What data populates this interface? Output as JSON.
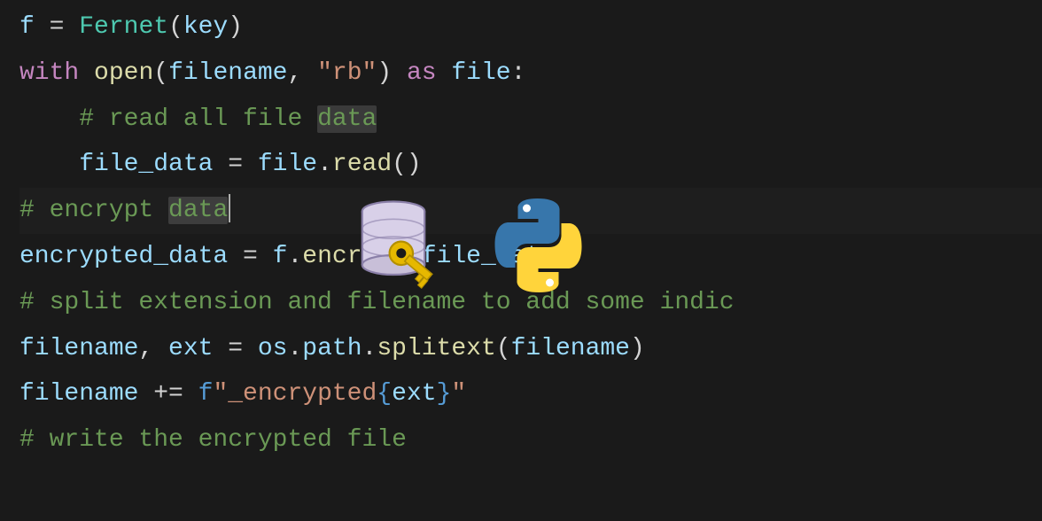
{
  "code": {
    "line1": {
      "var1": "f",
      "eq": " = ",
      "cls": "Fernet",
      "open": "(",
      "arg": "key",
      "close": ")"
    },
    "line2": {
      "kw1": "with",
      "sp1": " ",
      "fn": "open",
      "open": "(",
      "arg1": "filename",
      "comma": ", ",
      "str": "\"rb\"",
      "close": ")",
      "sp2": " ",
      "kw2": "as",
      "sp3": " ",
      "var": "file",
      "colon": ":"
    },
    "line3": {
      "indent": "    ",
      "comment_start": "# read all file ",
      "comment_hl": "data"
    },
    "line4": {
      "indent": "    ",
      "var": "file_data",
      "eq": " = ",
      "obj": "file",
      "dot": ".",
      "method": "read",
      "parens": "()"
    },
    "line5": {
      "comment_start": "# encrypt ",
      "comment_hl": "data"
    },
    "line6": {
      "var": "encrypted_data",
      "eq": " = ",
      "obj": "f",
      "dot": ".",
      "method": "encrypt",
      "open": "(",
      "arg": "file_data",
      "close": ")"
    },
    "line7": {
      "comment": "# split extension and filename to add some indic"
    },
    "line8": {
      "var1": "filename",
      "comma": ", ",
      "var2": "ext",
      "eq": " = ",
      "mod1": "os",
      "dot1": ".",
      "mod2": "path",
      "dot2": ".",
      "fn": "splitext",
      "open": "(",
      "arg": "filename",
      "close": ")"
    },
    "line9": {
      "var": "filename",
      "op": " += ",
      "fprefix": "f",
      "str1": "\"_encrypted",
      "braceopen": "{",
      "fexpr": "ext",
      "braceclose": "}",
      "str2": "\""
    },
    "line10": {
      "comment": "# write the encrypted file"
    }
  },
  "icons": {
    "database": "database-icon",
    "key": "key-icon",
    "python": "python-icon"
  }
}
